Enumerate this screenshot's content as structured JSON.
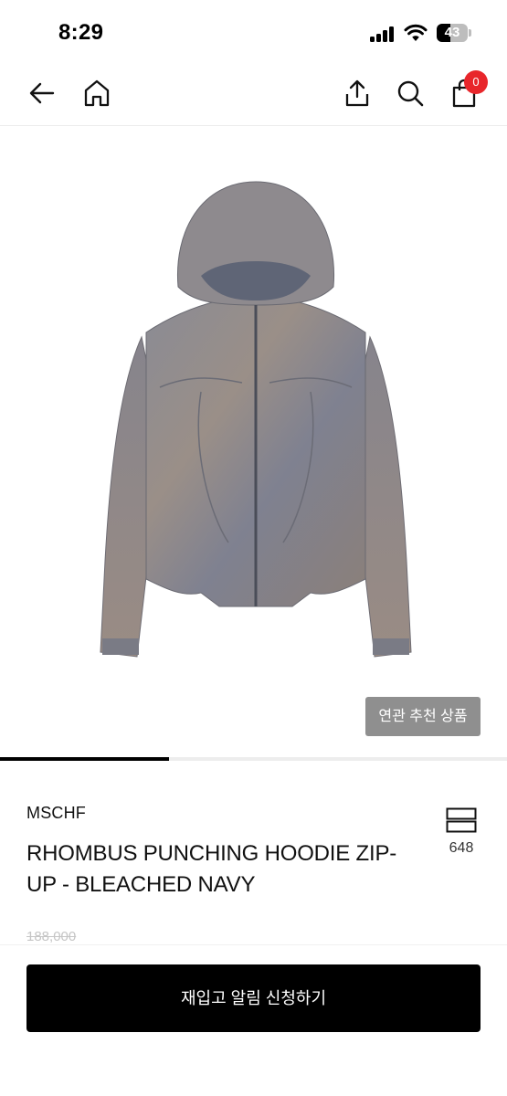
{
  "status_bar": {
    "time": "8:29",
    "battery": "43",
    "battery_level": 0.43
  },
  "nav": {
    "back_icon": "arrow-left-icon",
    "home_icon": "home-icon",
    "share_icon": "share-icon",
    "search_icon": "search-icon",
    "cart_icon": "shopping-bag-icon",
    "cart_count": "0"
  },
  "gallery": {
    "related_button_label": "연관 추천 상품",
    "progress": 0.333
  },
  "product": {
    "brand": "MSCHF",
    "name": "RHOMBUS PUNCHING HOODIE ZIP-UP - BLEACHED NAVY",
    "like_count": "648",
    "original_price": "188,000"
  },
  "bottom": {
    "restock_button_label": "재입고 알림 신청하기"
  },
  "colors": {
    "accent": "#000000",
    "badge": "#e8262b",
    "secondary_button": "#8f8f8f"
  }
}
